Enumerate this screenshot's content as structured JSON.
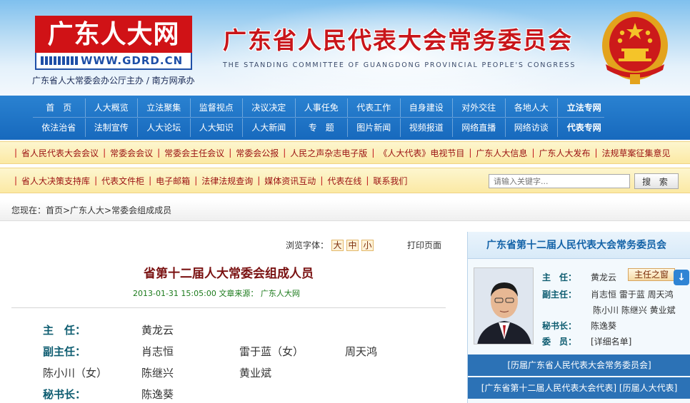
{
  "header": {
    "logo_title": "广东人大网",
    "logo_url": "WWW.GDRD.CN",
    "sponsor": "广东省人大常委会办公厅主办 / 南方网承办",
    "site_title": "广东省人民代表大会常务委员会",
    "site_subtitle": "THE STANDING COMMITTEE OF GUANGDONG PROVINCIAL PEOPLE'S CONGRESS"
  },
  "main_nav": {
    "row1": [
      "首　页",
      "人大概览",
      "立法聚集",
      "监督视点",
      "决议决定",
      "人事任免",
      "代表工作",
      "自身建设",
      "对外交往",
      "各地人大",
      "立法专网"
    ],
    "row2": [
      "依法治省",
      "法制宣传",
      "人大论坛",
      "人大知识",
      "人大新闻",
      "专　题",
      "图片新闻",
      "视频报道",
      "网络直播",
      "网络访谈",
      "代表专网"
    ]
  },
  "quick_links": [
    "省人民代表大会会议",
    "常委会会议",
    "常委会主任会议",
    "常委会公报",
    "人民之声杂志电子版",
    "《人大代表》电视节目",
    "广东人大信息",
    "广东人大发布",
    "法规草案征集意见"
  ],
  "tool_links": [
    "省人大决策支持库",
    "代表文件柜",
    "电子邮箱",
    "法律法规查询",
    "媒体资讯互动",
    "代表在线",
    "联系我们"
  ],
  "search": {
    "placeholder": "请输入关键字...",
    "button": "搜 索"
  },
  "breadcrumb": "您现在：首页>广东人大>常委会组成成员",
  "article": {
    "font_label": "浏览字体：",
    "font_sizes": [
      "大",
      "中",
      "小"
    ],
    "print": "打印页面",
    "title": "省第十二届人大常委会组成人员",
    "meta": "2013-01-31 15:05:00  文章来源：  广东人大网",
    "members": {
      "director_label": "主　任：",
      "director": "黄龙云",
      "deputy_label": "副主任：",
      "deputies": [
        "肖志恒",
        "雷于蓝（女）",
        "周天鸿",
        "陈小川（女）",
        "陈继兴",
        "黄业斌"
      ],
      "secretary_label": "秘书长：",
      "secretary": "陈逸葵"
    }
  },
  "sidebar": {
    "title": "广东省第十二届人民代表大会常务委员会",
    "director_label": "主　任：",
    "director": "黄龙云",
    "window_button": "主任之窗",
    "deputy_label": "副主任：",
    "deputies_line1": "肖志恒 雷于蓝 周天鸿",
    "deputies_line2": "陈小川 陈继兴 黄业斌",
    "secretary_label": "秘书长：",
    "secretary": "陈逸葵",
    "member_label": "委　员：",
    "member_list": "[详细名单]",
    "link_past": "[历届广东省人民代表大会常务委员会]",
    "link_deputies": "[广东省第十二届人民代表大会代表]  [历届人大代表]"
  }
}
